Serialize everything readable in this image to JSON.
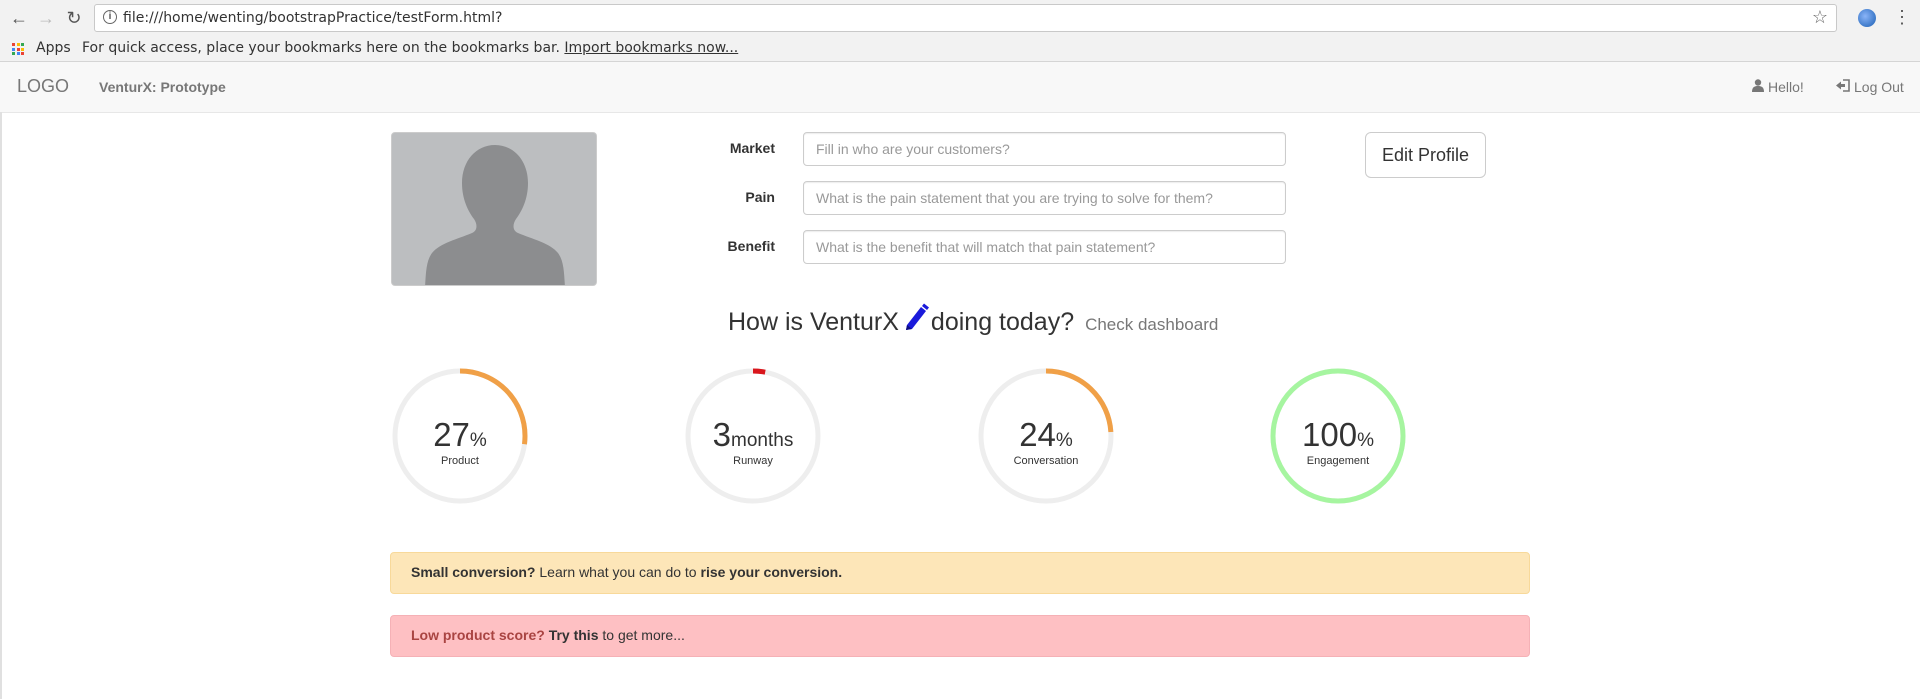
{
  "browser": {
    "url": "file:///home/wenting/bootstrapPractice/testForm.html?",
    "apps_label": "Apps",
    "bookmarks_message": "For quick access, place your bookmarks here on the bookmarks bar.",
    "import_link": "Import bookmarks now...",
    "back_glyph": "←",
    "forward_glyph": "→",
    "reload_glyph": "↻",
    "star_glyph": "☆",
    "menu_glyph": "⋮"
  },
  "navbar": {
    "logo": "LOGO",
    "brand": "VenturX: Prototype",
    "hello": "Hello!",
    "logout": "Log Out"
  },
  "profile": {
    "fields": [
      {
        "label": "Market",
        "placeholder": "Fill in who are your customers?"
      },
      {
        "label": "Pain",
        "placeholder": "What is the pain statement that you are trying to solve for them?"
      },
      {
        "label": "Benefit",
        "placeholder": "What is the benefit that will match that pain statement?"
      }
    ],
    "edit_button": "Edit Profile"
  },
  "status": {
    "question_prefix": "How is VenturX",
    "question_suffix": "doing today?",
    "dashboard_link": "Check dashboard"
  },
  "gauges": [
    {
      "value": "27",
      "unit": "%",
      "label": "Product",
      "fraction": 0.27,
      "color": "#f0a047"
    },
    {
      "value": "3",
      "unit": "months",
      "label": "Runway",
      "fraction": 0.03,
      "color": "#d9161c"
    },
    {
      "value": "24",
      "unit": "%",
      "label": "Conversation",
      "fraction": 0.24,
      "color": "#f0a047"
    },
    {
      "value": "100",
      "unit": "%",
      "label": "Engagement",
      "fraction": 1.0,
      "color": "#a6f5a0"
    }
  ],
  "alerts": {
    "warning": {
      "bold_lead": "Small conversion?",
      "text": "Learn what you can do to",
      "bold_tail": "rise your conversion."
    },
    "danger": {
      "bold_lead": "Low product score?",
      "bold_link": "Try this",
      "text": "to get more..."
    }
  },
  "colors": {
    "gauge_track": "#eeeeee",
    "pencil": "#1a1adb",
    "warning_bg": "#fde6b8",
    "danger_bg": "#fec0c3",
    "danger_text": "#a94442"
  }
}
